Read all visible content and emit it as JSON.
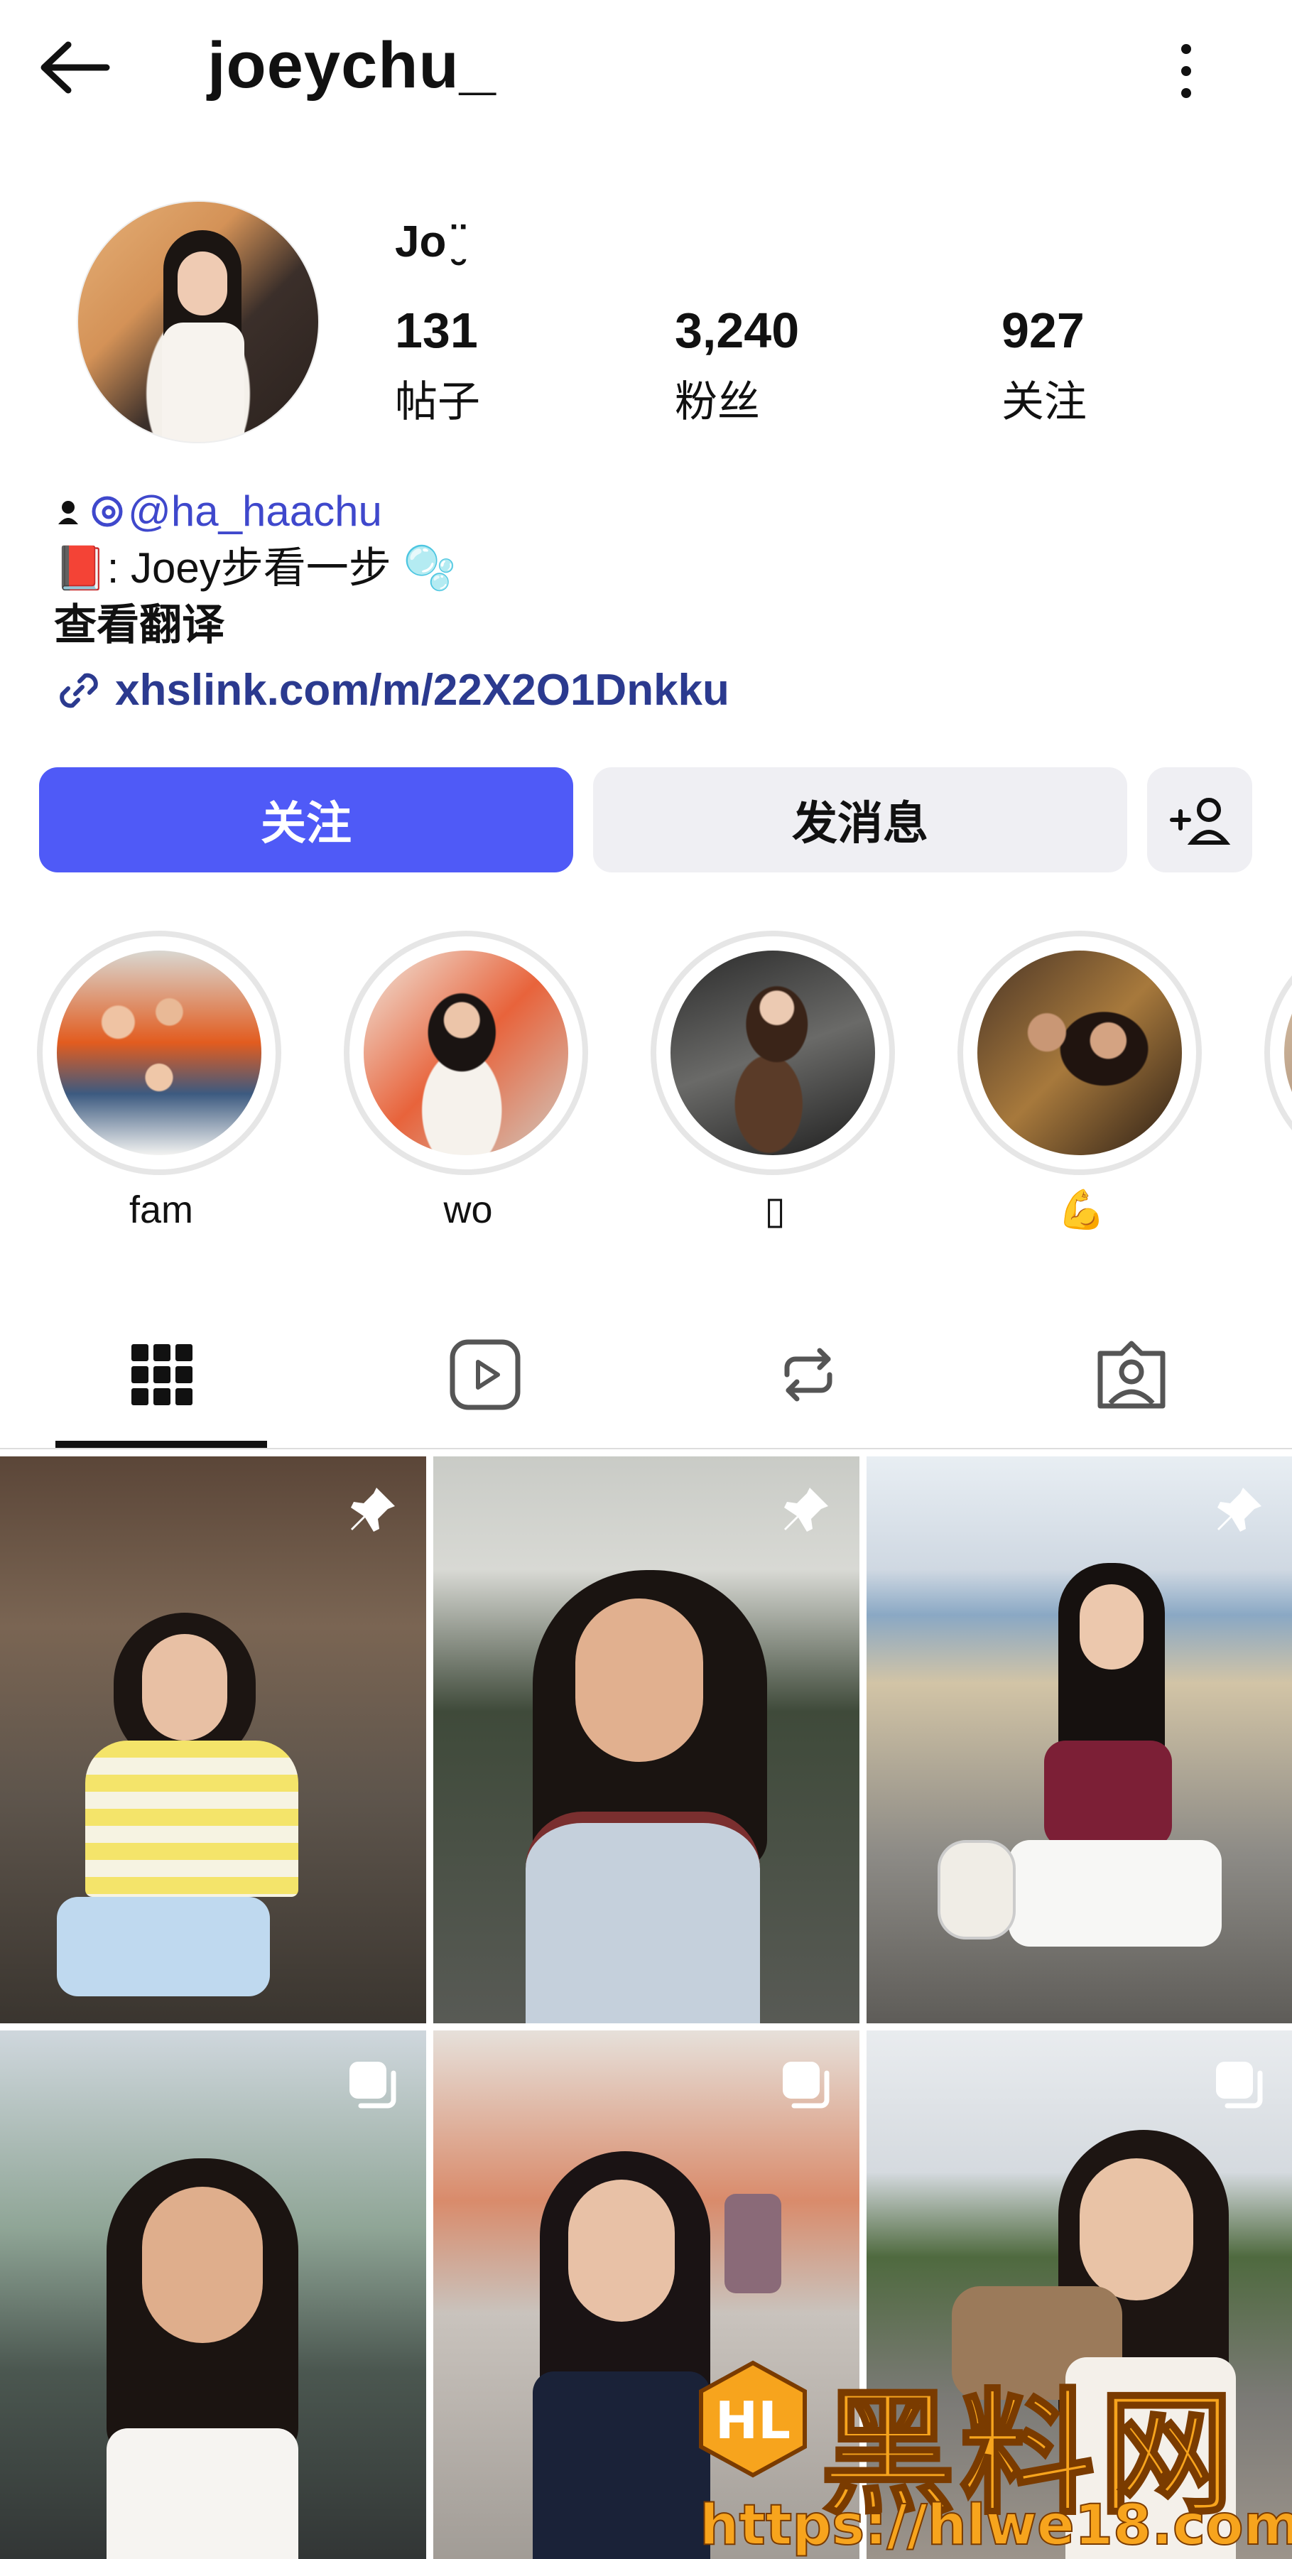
{
  "header": {
    "username": "joeychu_"
  },
  "profile": {
    "display_name": "Jo ̮̈",
    "stats": [
      {
        "value": "131",
        "label": "帖子"
      },
      {
        "value": "3,240",
        "label": "粉丝"
      },
      {
        "value": "927",
        "label": "关注"
      }
    ]
  },
  "bio": {
    "threads_handle": "@ha_haachu",
    "line2": "📕: Joey步看一步 🫧",
    "translate": "查看翻译",
    "link": "xhslink.com/m/22X2O1Dnkku"
  },
  "actions": {
    "follow": "关注",
    "message": "发消息"
  },
  "highlights": [
    {
      "label": "fam"
    },
    {
      "label": "wo"
    },
    {
      "label": "▯"
    },
    {
      "label": "💪"
    }
  ],
  "watermark": {
    "brand": "黑料网",
    "url": "https://hlwe18.com"
  },
  "colors": {
    "accent": "#4f5af7",
    "link": "#2b3a8f"
  }
}
